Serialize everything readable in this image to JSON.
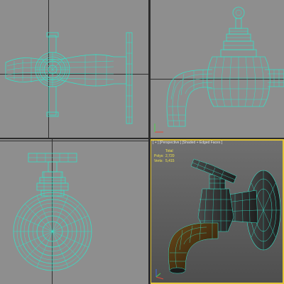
{
  "viewports": {
    "top_left": {
      "label": ""
    },
    "top_right": {
      "label": ""
    },
    "bottom_left": {
      "label": ""
    },
    "bottom_right": {
      "label": "[ + ] [Perspective ] [Shaded + Edged Faces ]"
    }
  },
  "stats": {
    "header": "Total",
    "polys_label": "Polys:",
    "polys_value": "2,720",
    "verts_label": "Verts:",
    "verts_value": "5,415"
  },
  "colors": {
    "wireframe": "#36e0c6",
    "viewport_bg": "#8e8e8e",
    "active_border": "#e2c53a",
    "shaded_body": "#4a3410"
  }
}
